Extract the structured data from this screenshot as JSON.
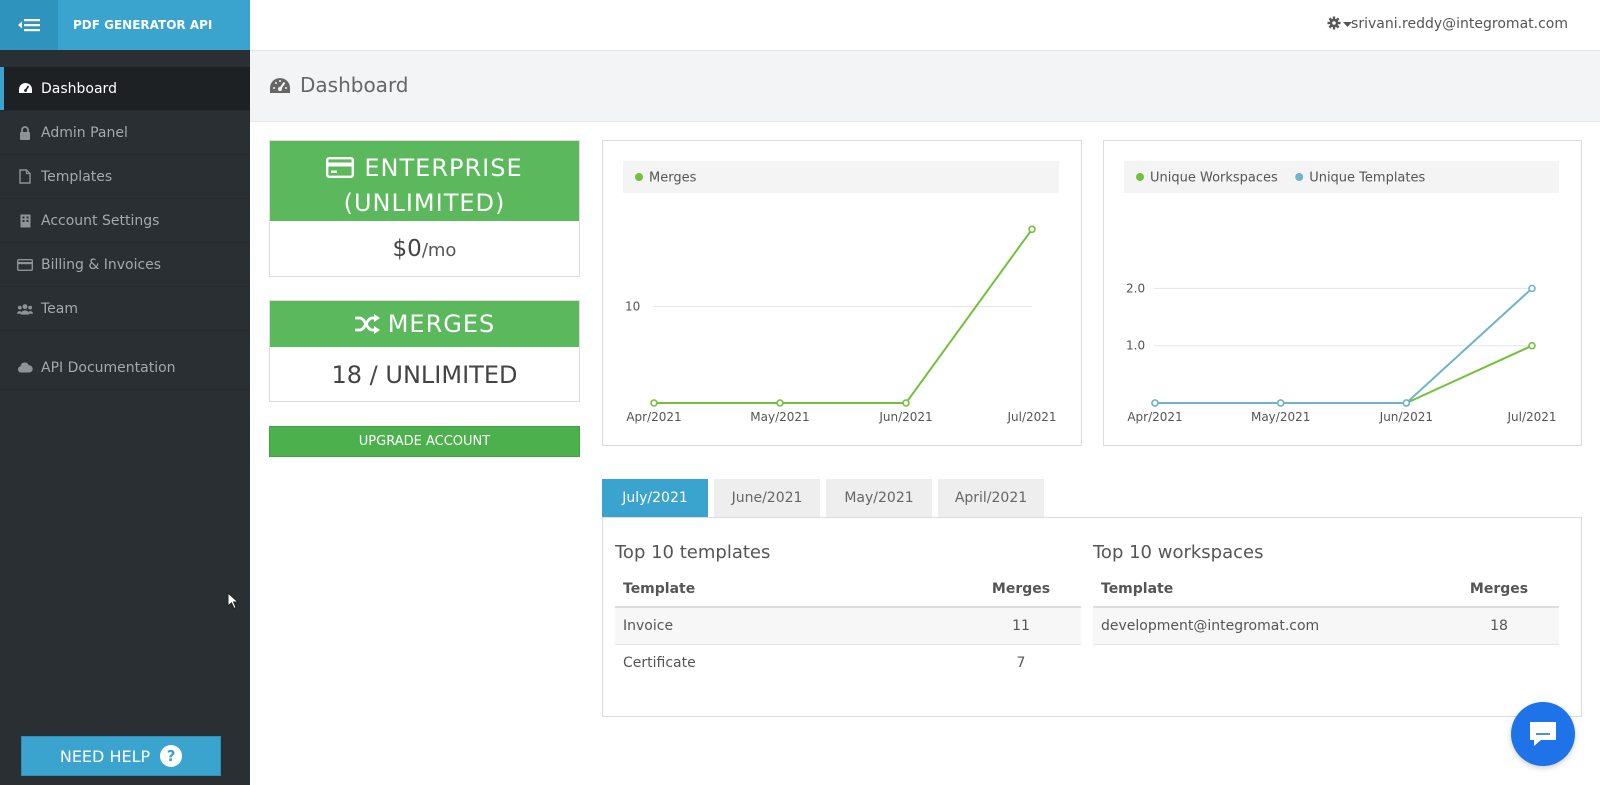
{
  "app": {
    "brand": "PDF GENERATOR API",
    "accent": "#3aa4cf",
    "success": "#5cb85c"
  },
  "sidebar": {
    "items": [
      {
        "label": "Dashboard",
        "icon": "dashboard-icon",
        "active": true
      },
      {
        "label": "Admin Panel",
        "icon": "lock-icon"
      },
      {
        "label": "Templates",
        "icon": "file-icon"
      },
      {
        "label": "Account Settings",
        "icon": "building-icon"
      },
      {
        "label": "Billing & Invoices",
        "icon": "credit-card-icon"
      },
      {
        "label": "Team",
        "icon": "users-icon"
      },
      {
        "label": "API Documentation",
        "icon": "cloud-icon"
      }
    ],
    "need_help": "NEED HELP"
  },
  "topbar": {
    "user_email": "srivani.reddy@integromat.com"
  },
  "page": {
    "title": "Dashboard"
  },
  "plan": {
    "line1": "ENTERPRISE",
    "line2": "(UNLIMITED)",
    "price": "$0",
    "price_unit": "/mo"
  },
  "merges": {
    "title": "MERGES",
    "usage": "18 / UNLIMITED"
  },
  "upgrade_label": "UPGRADE ACCOUNT",
  "chart_data": [
    {
      "type": "line",
      "categories": [
        "Apr/2021",
        "May/2021",
        "Jun/2021",
        "Jul/2021"
      ],
      "series": [
        {
          "name": "Merges",
          "color": "#72c13c",
          "values": [
            0,
            0,
            0,
            18
          ]
        }
      ],
      "yticks": [
        10
      ],
      "ylim": [
        0,
        20
      ],
      "legend": "top"
    },
    {
      "type": "line",
      "categories": [
        "Apr/2021",
        "May/2021",
        "Jun/2021",
        "Jul/2021"
      ],
      "series": [
        {
          "name": "Unique Workspaces",
          "color": "#72c13c",
          "values": [
            0,
            0,
            0,
            1
          ]
        },
        {
          "name": "Unique Templates",
          "color": "#6fb3cc",
          "values": [
            0,
            0,
            0,
            2
          ]
        }
      ],
      "yticks": [
        "1.0",
        "2.0"
      ],
      "ylim": [
        0,
        2.6
      ],
      "legend": "top"
    }
  ],
  "tabs": [
    "July/2021",
    "June/2021",
    "May/2021",
    "April/2021"
  ],
  "top_templates": {
    "title": "Top 10 templates",
    "headers": [
      "Template",
      "Merges"
    ],
    "rows": [
      [
        "Invoice",
        "11"
      ],
      [
        "Certificate",
        "7"
      ]
    ]
  },
  "top_workspaces": {
    "title": "Top 10 workspaces",
    "headers": [
      "Template",
      "Merges"
    ],
    "rows": [
      [
        "development@integromat.com",
        "18"
      ]
    ]
  }
}
